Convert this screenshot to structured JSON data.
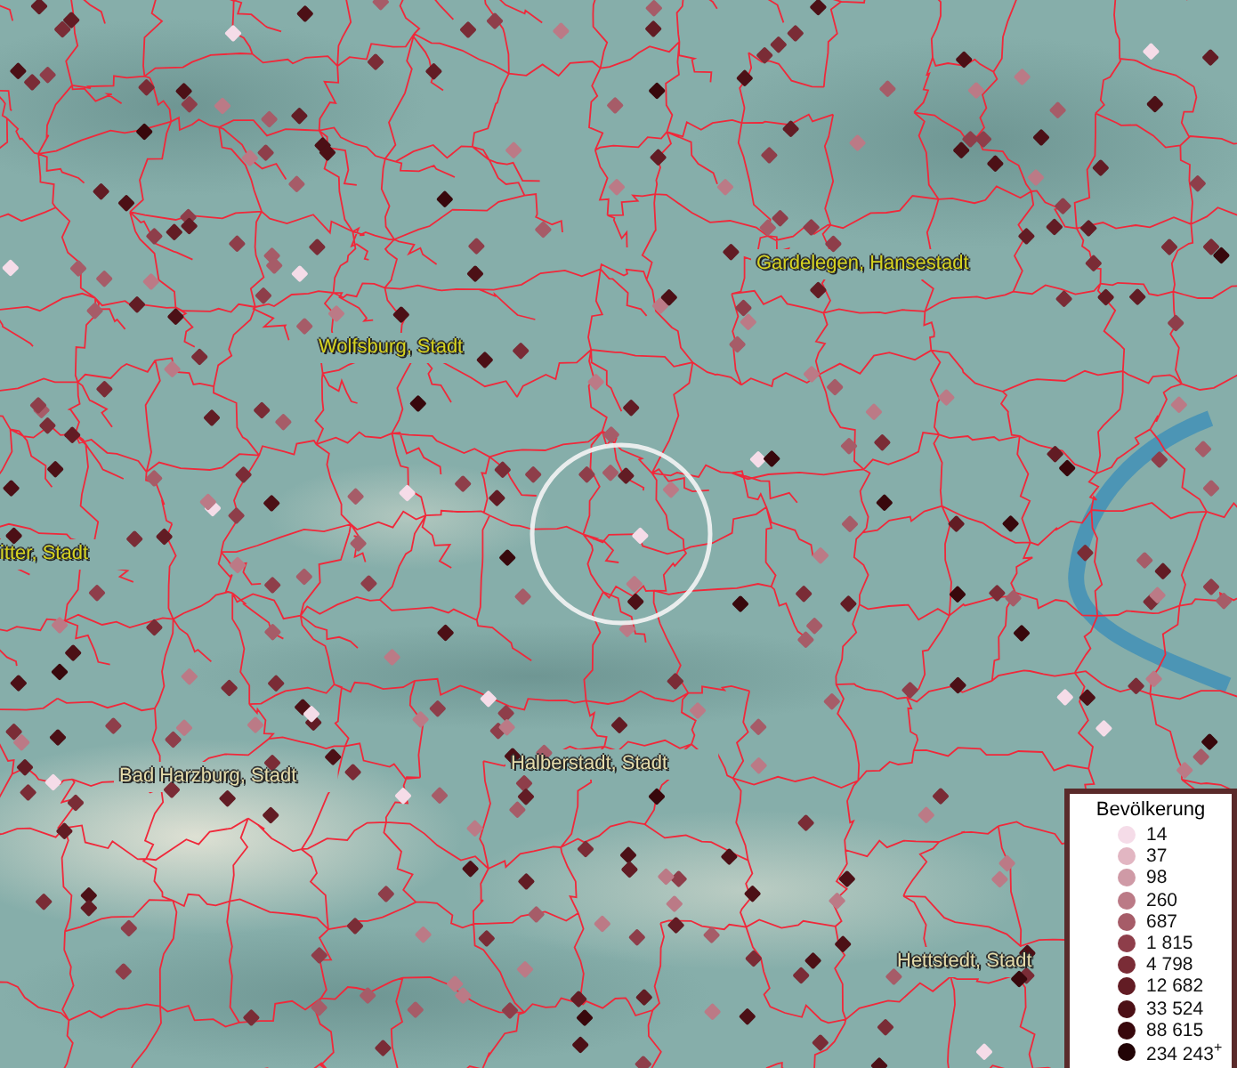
{
  "map": {
    "place_labels": [
      {
        "text": "Gardelegen, Hansestadt"
      },
      {
        "text": "Wolfsburg, Stadt"
      },
      {
        "text": "itter, Stadt"
      },
      {
        "text": "Bad Harzburg, Stadt"
      },
      {
        "text": "Halberstadt, Stadt"
      },
      {
        "text": "Hettstedt, Stadt"
      }
    ]
  },
  "legend": {
    "title": "Bevölkerung",
    "items": [
      {
        "label": "14",
        "color": "#f5dce8"
      },
      {
        "label": "37",
        "color": "#e2b6c2"
      },
      {
        "label": "98",
        "color": "#cf9aa6"
      },
      {
        "label": "260",
        "color": "#bb7a86"
      },
      {
        "label": "687",
        "color": "#a65c68"
      },
      {
        "label": "1 815",
        "color": "#8e3e4a"
      },
      {
        "label": "4 798",
        "color": "#7a2c36"
      },
      {
        "label": "12 682",
        "color": "#621c24"
      },
      {
        "label": "33 524",
        "color": "#4c1016"
      },
      {
        "label": "88 615",
        "color": "#38080c"
      },
      {
        "label": "234 243$^{+}$",
        "color": "#220406"
      }
    ]
  }
}
